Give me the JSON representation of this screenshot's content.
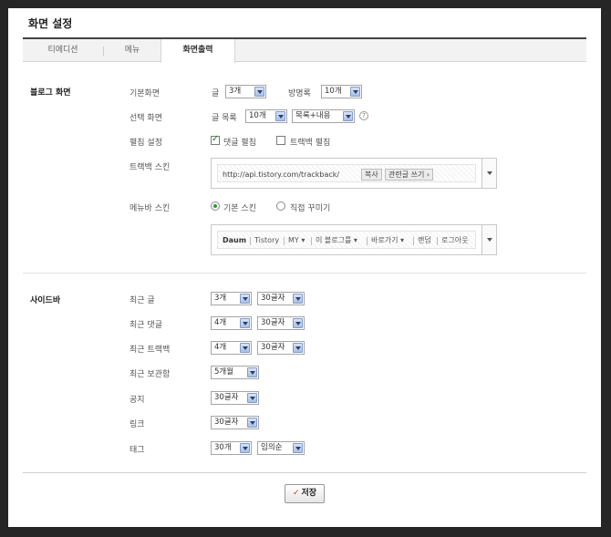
{
  "page": {
    "title": "화면 설정"
  },
  "tabs": [
    {
      "label": "티에디션"
    },
    {
      "label": "메뉴"
    },
    {
      "label": "화면출력"
    }
  ],
  "blog_screen": {
    "section_title": "블로그 화면",
    "basic": {
      "label": "기본화면",
      "post_label": "글",
      "post_value": "3개",
      "guestbook_label": "방명록",
      "guestbook_value": "10개"
    },
    "selected": {
      "label": "선택 화면",
      "list_label": "글 목록",
      "list_value": "10개",
      "mode_value": "목록+내용",
      "help": "?"
    },
    "expand": {
      "label": "펼침 설정",
      "comment_label": "댓글 펼침",
      "comment_checked": true,
      "trackback_label": "트랙백 펼침",
      "trackback_checked": false
    },
    "trackback_skin": {
      "label": "트랙백 스킨",
      "url": "http://api.tistory.com/trackback/",
      "copy_btn": "복사",
      "write_btn": "관련글 쓰기 ›"
    },
    "menubar_skin": {
      "label": "메뉴바 스킨",
      "default_label": "기본 스킨",
      "default_selected": true,
      "custom_label": "직접 꾸미기",
      "custom_selected": false,
      "items": [
        "Daum",
        "Tistory",
        "MY ▾",
        "이 블로그를 ▾",
        "바로가기 ▾",
        "랜덤",
        "로그아웃"
      ]
    }
  },
  "sidebar": {
    "section_title": "사이드바",
    "rows": [
      {
        "label": "최근 글",
        "count": "3개",
        "length": "30글자"
      },
      {
        "label": "최근 댓글",
        "count": "4개",
        "length": "30글자"
      },
      {
        "label": "최근 트랙백",
        "count": "4개",
        "length": "30글자"
      },
      {
        "label": "최근 보관함",
        "count": "5개월"
      },
      {
        "label": "공지",
        "length": "30글자"
      },
      {
        "label": "링크",
        "length": "30글자"
      },
      {
        "label": "태그",
        "count": "30개",
        "order": "임의순"
      }
    ]
  },
  "footer": {
    "save_label": "저장"
  }
}
